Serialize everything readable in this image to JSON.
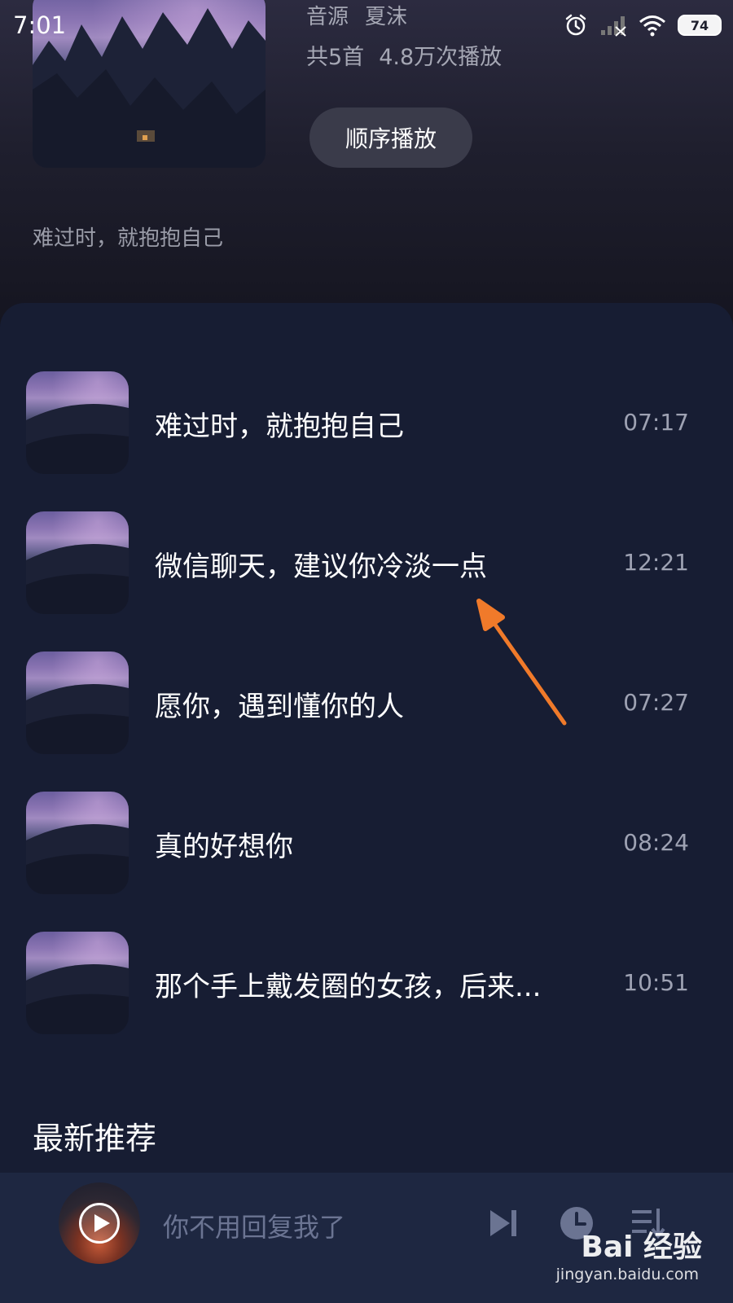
{
  "status_bar": {
    "time": "7:01",
    "battery": "74",
    "icons": [
      "alarm-icon",
      "signal-icon",
      "wifi-icon",
      "battery-icon"
    ]
  },
  "header": {
    "source_label": "音源",
    "source_value": "夏沫",
    "song_count": "共5首",
    "play_count": "4.8万次播放",
    "play_order_button": "顺序播放",
    "description": "难过时，就抱抱自己"
  },
  "songs": [
    {
      "title": "难过时，就抱抱自己",
      "duration": "07:17"
    },
    {
      "title": "微信聊天，建议你冷淡一点",
      "duration": "12:21"
    },
    {
      "title": "愿你，遇到懂你的人",
      "duration": "07:27"
    },
    {
      "title": "真的好想你",
      "duration": "08:24"
    },
    {
      "title": "那个手上戴发圈的女孩，后来...",
      "duration": "10:51"
    }
  ],
  "section": {
    "title": "最新推荐"
  },
  "player": {
    "now_playing": "你不用回复我了",
    "icons": [
      "play-icon",
      "next-track-icon",
      "timer-icon",
      "playlist-icon"
    ]
  },
  "watermark": {
    "logo": "Bai 经验",
    "url": "jingyan.baidu.com"
  },
  "colors": {
    "panel_bg": "#171d33",
    "player_bg": "#1e2741",
    "arrow": "#f07a2a"
  }
}
